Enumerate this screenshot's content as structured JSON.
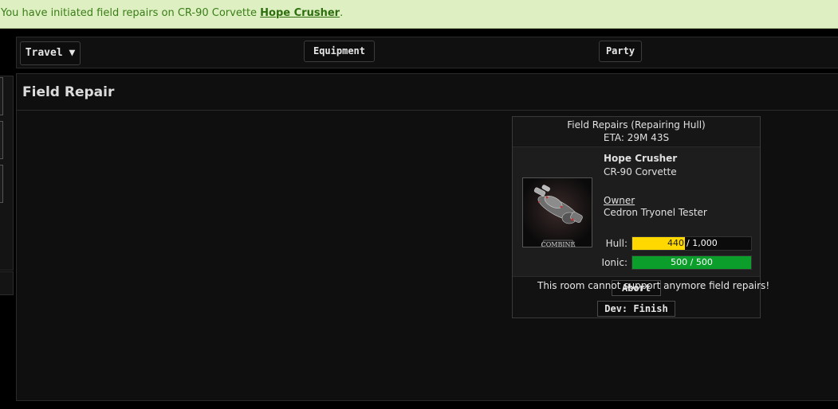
{
  "notice": {
    "prefix": "You have initiated field repairs on CR-90 Corvette ",
    "link": "Hope Crusher",
    "suffix": "."
  },
  "nav": {
    "travel": "Travel ▼",
    "equipment": "Equipment",
    "party": "Party"
  },
  "page": {
    "title": "Field Repair"
  },
  "repair": {
    "header_line1": "Field Repairs (Repairing Hull)",
    "header_line2": "ETA: 29M 43S",
    "ship_name": "Hope Crusher",
    "ship_class": "CR-90 Corvette",
    "image_caption": "COMBINE",
    "owner_label": "Owner",
    "owner_name": "Cedron Tryonel Tester",
    "hull": {
      "label": "Hull:",
      "current": "440",
      "max_text": "/ 1,000",
      "fraction": 0.44
    },
    "ionic": {
      "label": "Ionic:",
      "text": "500 / 500",
      "fraction": 1.0
    },
    "abort_label": "Abort",
    "finish_label": "Dev: Finish"
  },
  "room_message": "This room cannot support anymore field repairs!",
  "colors": {
    "hull_bar": "#ffd800",
    "ionic_bar": "#0b9e2b",
    "notice_bg": "#def0c2"
  }
}
